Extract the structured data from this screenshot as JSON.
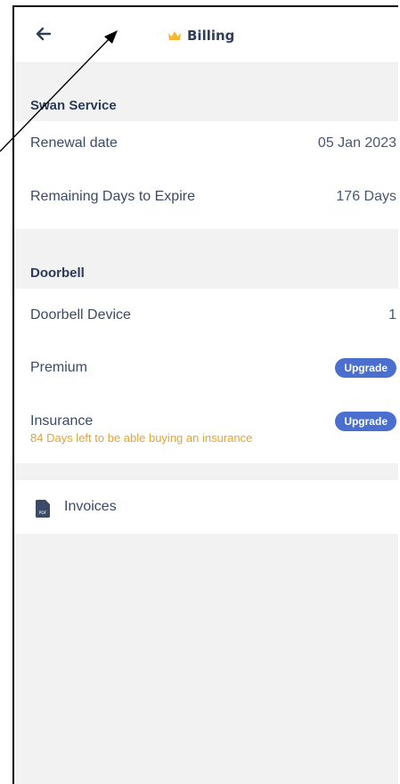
{
  "header": {
    "title": "Billing",
    "back_icon": "arrow-left-icon",
    "title_icon": "crown-icon"
  },
  "swan_service": {
    "title": "Swan Service",
    "renewal_label": "Renewal date",
    "renewal_value": "05 Jan 2023",
    "remaining_label": "Remaining Days to Expire",
    "remaining_value": "176 Days"
  },
  "doorbell": {
    "title": "Doorbell",
    "device_label": "Doorbell Device",
    "device_value": "1",
    "premium_label": "Premium",
    "premium_button": "Upgrade",
    "insurance_label": "Insurance",
    "insurance_button": "Upgrade",
    "insurance_note": "84 Days left to be able buying an insurance"
  },
  "invoices": {
    "label": "Invoices",
    "icon": "pdf-file-icon",
    "icon_text": "PDF"
  },
  "colors": {
    "accent": "#4b6fcf",
    "warning": "#e8a230",
    "crown": "#f5b82e",
    "text": "#3b4a66"
  }
}
